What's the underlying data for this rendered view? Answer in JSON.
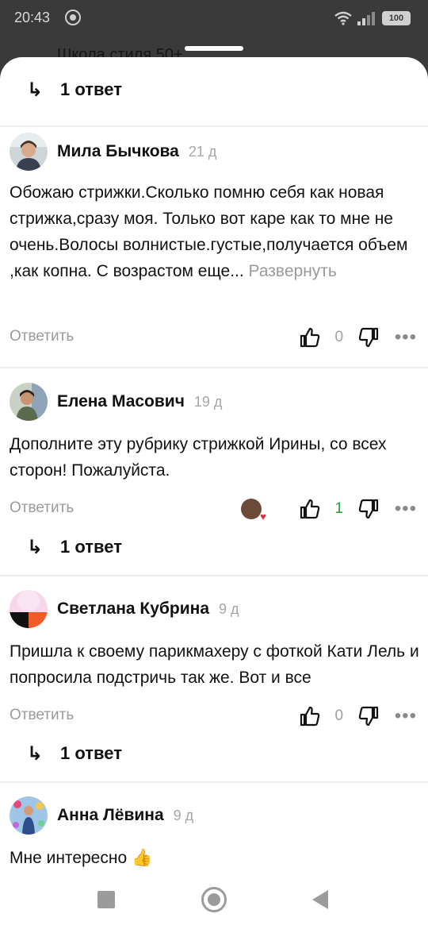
{
  "status": {
    "time": "20:43",
    "battery": "100"
  },
  "background_title": "Школа стиля 50+",
  "replies_label": "1 ответ",
  "answer_label": "Ответить",
  "expand_label": "Развернуть",
  "comments": [
    {
      "author": "Мила Бычкова",
      "age": "21 д",
      "text": "Обожаю стрижки.Сколько помню себя как новая стрижка,сразу моя. Только вот каре как то мне не очень.Волосы волнистые.густые,получается объем ,как копна. С возрастом еще...",
      "likes": "0"
    },
    {
      "author": "Елена Масович",
      "age": "19 д",
      "text": "Дополните эту рубрику стрижкой Ирины, со всех сторон! Пожалуйста.",
      "likes": "1"
    },
    {
      "author": "Светлана Кубрина",
      "age": "9 д",
      "text": "Пришла к своему парикмахеру с фоткой Кати Лель и попросила подстричь так же. Вот и все",
      "likes": "0"
    },
    {
      "author": "Анна Лёвина",
      "age": "9 д",
      "text": "Мне интересно 👍"
    }
  ],
  "colors": {
    "like_green": "#2e9b3b",
    "secondary_text": "#9a9a9a"
  }
}
